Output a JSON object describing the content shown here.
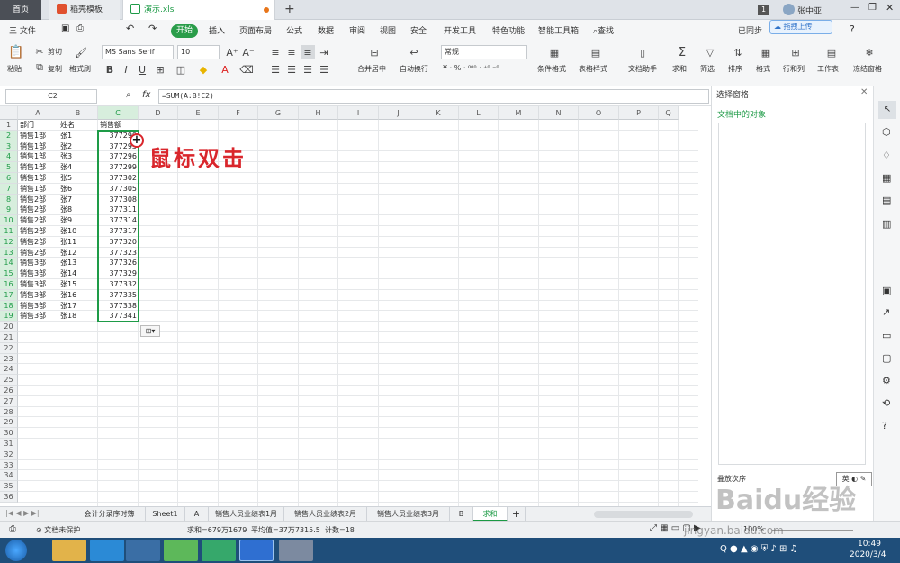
{
  "tabs": {
    "home": "首页",
    "template": "稻壳模板",
    "doc": "演示.xls",
    "new_tab": "+",
    "badge": "1",
    "user": "张中亚",
    "upload": "拖拽上传"
  },
  "menu": {
    "file": "三 文件",
    "start": "开始",
    "items": [
      "插入",
      "页面布局",
      "公式",
      "数据",
      "审阅",
      "视图",
      "安全",
      "开发工具",
      "特色功能",
      "智能工具箱",
      "查找"
    ],
    "sync": "已同步"
  },
  "ribbon": {
    "paste": "粘贴",
    "cut": "剪切",
    "copy": "复制",
    "format_painter": "格式刷",
    "font_name": "MS Sans Serif",
    "font_size": "10",
    "merge": "合并居中",
    "wrap": "自动换行",
    "number_format": "常规",
    "cond_format": "条件格式",
    "table_style": "表格样式",
    "doc_helper": "文档助手",
    "sum": "求和",
    "filter": "筛选",
    "sort": "排序",
    "format": "格式",
    "rowcol": "行和列",
    "worksheet": "工作表",
    "freeze": "冻结窗格"
  },
  "formula_bar": {
    "name_box": "C2",
    "fx": "fx",
    "formula": "=SUM(A:B!C2)"
  },
  "grid": {
    "columns": [
      "A",
      "B",
      "C",
      "D",
      "E",
      "F",
      "G",
      "H",
      "I",
      "J",
      "K",
      "L",
      "M",
      "N",
      "O",
      "P",
      "Q"
    ],
    "row_numbers": [
      "1",
      "2",
      "3",
      "4",
      "5",
      "6",
      "7",
      "8",
      "9",
      "10",
      "11",
      "12",
      "13",
      "14",
      "15",
      "16",
      "17",
      "18",
      "19",
      "20",
      "21",
      "22",
      "23",
      "24",
      "25",
      "26",
      "27",
      "28",
      "29",
      "30",
      "31",
      "32",
      "33",
      "34",
      "35",
      "36"
    ],
    "header_row": [
      "部门",
      "姓名",
      "销售额"
    ],
    "rows": [
      [
        "销售1部",
        "张1",
        "377290"
      ],
      [
        "销售1部",
        "张2",
        "377293"
      ],
      [
        "销售1部",
        "张3",
        "377296"
      ],
      [
        "销售1部",
        "张4",
        "377299"
      ],
      [
        "销售1部",
        "张5",
        "377302"
      ],
      [
        "销售1部",
        "张6",
        "377305"
      ],
      [
        "销售2部",
        "张7",
        "377308"
      ],
      [
        "销售2部",
        "张8",
        "377311"
      ],
      [
        "销售2部",
        "张9",
        "377314"
      ],
      [
        "销售2部",
        "张10",
        "377317"
      ],
      [
        "销售2部",
        "张11",
        "377320"
      ],
      [
        "销售2部",
        "张12",
        "377323"
      ],
      [
        "销售3部",
        "张13",
        "377326"
      ],
      [
        "销售3部",
        "张14",
        "377329"
      ],
      [
        "销售3部",
        "张15",
        "377332"
      ],
      [
        "销售3部",
        "张16",
        "377335"
      ],
      [
        "销售3部",
        "张17",
        "377338"
      ],
      [
        "销售3部",
        "张18",
        "377341"
      ]
    ],
    "annotation": "鼠标双击",
    "annotation_color": "#d9262c",
    "selection_color": "#1e9b47"
  },
  "pane": {
    "title": "选择窗格",
    "subtitle": "文档中的对象",
    "order": "叠放次序",
    "ime": "英"
  },
  "sheets": [
    "会计分录序时簿",
    "Sheet1",
    "A",
    "销售人员业绩表1月",
    "销售人员业绩表2月",
    "销售人员业绩表3月",
    "B",
    "求和"
  ],
  "active_sheet": "求和",
  "status": {
    "protect": "文档未保护",
    "sum": "求和=679万1679",
    "avg": "平均值=37万7315.5",
    "count": "计数=18",
    "zoom": "100%",
    "time": "10:49",
    "date": "2020/3/4"
  },
  "watermark": "Baidu经验",
  "watermark_sub": "jingyan.baidu.com"
}
